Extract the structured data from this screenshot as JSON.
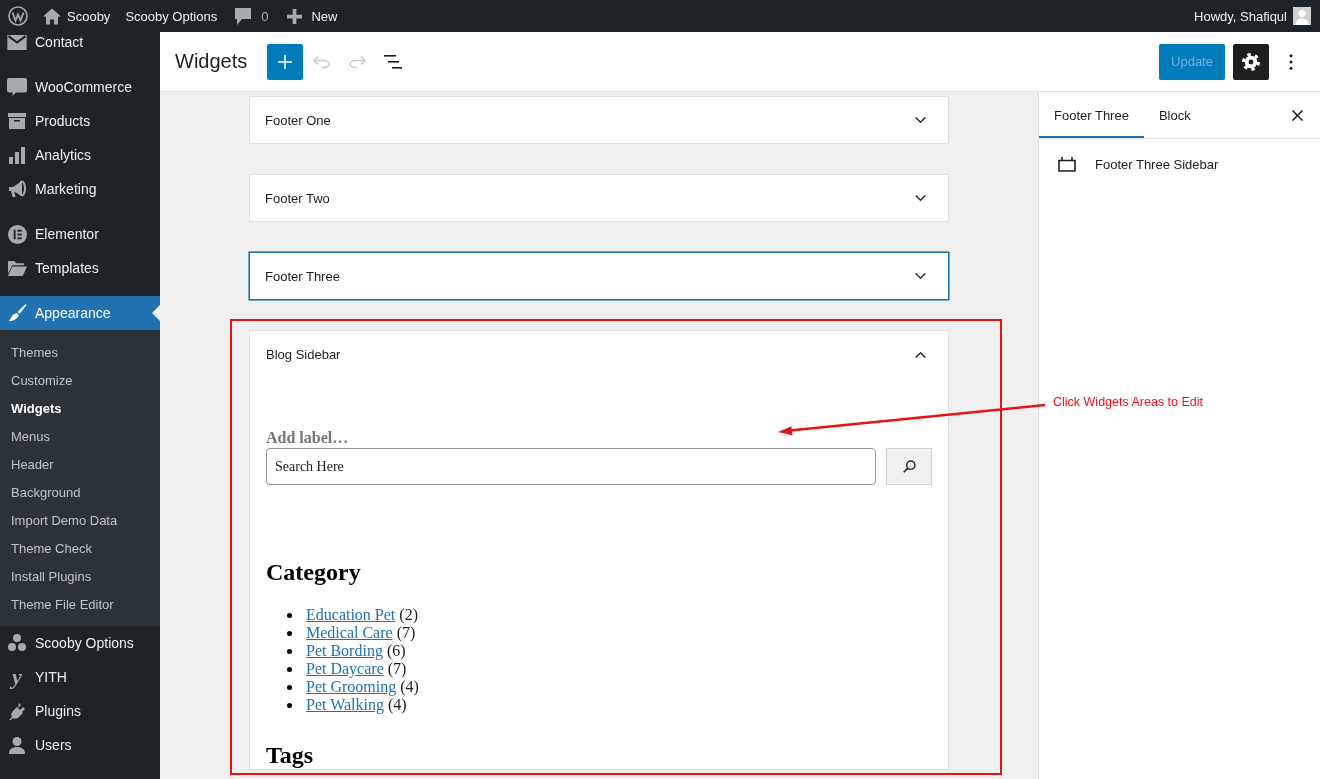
{
  "admin_bar": {
    "site_name": "Scooby",
    "menu_label": "Scooby Options",
    "comment_count": "0",
    "new_label": "New",
    "greeting": "Howdy, Shafiqul"
  },
  "sidebar": {
    "sections": [
      {
        "items": [
          {
            "label": "Contact",
            "selected": false
          }
        ]
      },
      {
        "items": [
          {
            "label": "WooCommerce",
            "selected": false
          },
          {
            "label": "Products",
            "selected": false
          },
          {
            "label": "Analytics",
            "selected": false
          },
          {
            "label": "Marketing",
            "selected": false
          }
        ]
      },
      {
        "items": [
          {
            "label": "Elementor",
            "selected": false
          },
          {
            "label": "Templates",
            "selected": false
          }
        ]
      },
      {
        "items": [
          {
            "label": "Appearance",
            "selected": true,
            "children": [
              {
                "label": "Themes",
                "selected": false
              },
              {
                "label": "Customize",
                "selected": false
              },
              {
                "label": "Widgets",
                "selected": true
              },
              {
                "label": "Menus",
                "selected": false
              },
              {
                "label": "Header",
                "selected": false
              },
              {
                "label": "Background",
                "selected": false
              },
              {
                "label": "Import Demo Data",
                "selected": false
              },
              {
                "label": "Theme Check",
                "selected": false
              },
              {
                "label": "Install Plugins",
                "selected": false
              },
              {
                "label": "Theme File Editor",
                "selected": false
              }
            ]
          },
          {
            "label": "Scooby Options",
            "selected": false
          },
          {
            "label": "YITH",
            "selected": false,
            "glyph": "y"
          },
          {
            "label": "Plugins",
            "selected": false
          },
          {
            "label": "Users",
            "selected": false
          }
        ]
      }
    ]
  },
  "toolbar": {
    "title": "Widgets",
    "undo": {
      "disabled": true
    },
    "redo": {
      "disabled": true
    },
    "update": {
      "label": "Update",
      "disabled": true
    },
    "settings": {
      "pressed": true
    }
  },
  "widget_areas": [
    {
      "title": "Footer One",
      "selected": false,
      "expanded": false
    },
    {
      "title": "Footer Two",
      "selected": false,
      "expanded": false
    },
    {
      "title": "Footer Three",
      "selected": true,
      "expanded": false
    },
    {
      "title": "Blog Sidebar",
      "selected": false,
      "expanded": true,
      "blocks": [
        {
          "kind": "search",
          "label": {
            "placeholder": "Add label…"
          },
          "value": "Search Here"
        },
        {
          "kind": "categories",
          "heading": "Category",
          "items": [
            {
              "name": "Education Pet",
              "count": "(2)"
            },
            {
              "name": "Medical Care",
              "count": "(7)"
            },
            {
              "name": "Pet Bording",
              "count": "(6)"
            },
            {
              "name": "Pet Daycare",
              "count": "(7)"
            },
            {
              "name": "Pet Grooming",
              "count": "(4)"
            },
            {
              "name": "Pet Walking",
              "count": "(4)"
            }
          ]
        },
        {
          "kind": "heading",
          "text": "Tags"
        }
      ]
    }
  ],
  "inspector": {
    "tabs": [
      {
        "label": "Footer Three",
        "selected": true
      },
      {
        "label": "Block",
        "selected": false
      }
    ],
    "area_name": "Footer Three Sidebar"
  },
  "annotation": {
    "text": "Click Widgets Areas to Edit"
  }
}
